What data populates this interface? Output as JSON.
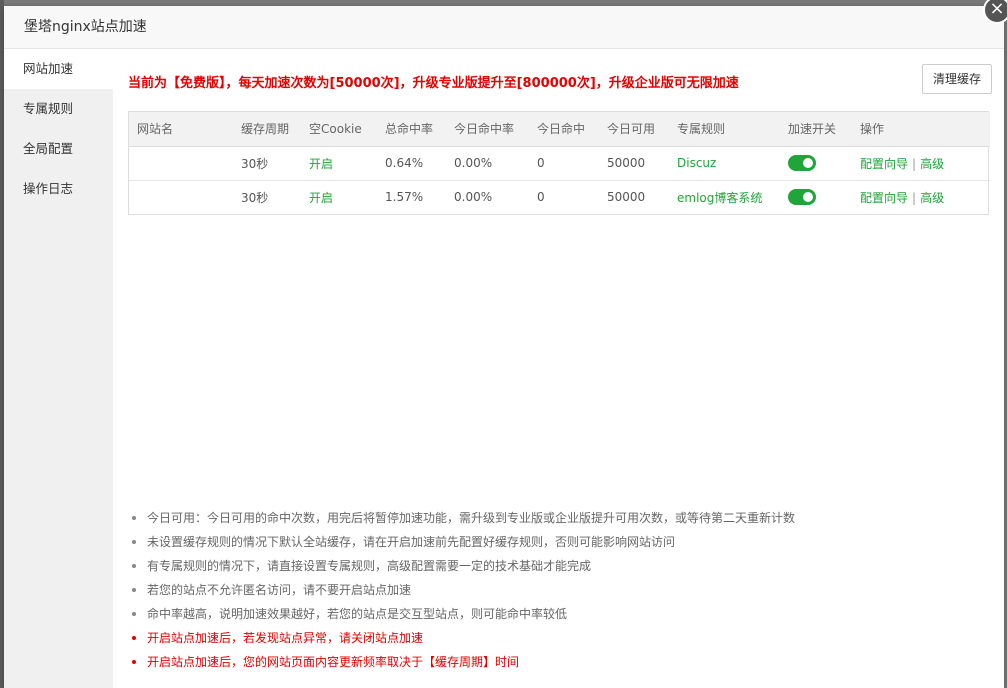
{
  "dialog": {
    "title": "堡塔nginx站点加速",
    "close_glyph": "×"
  },
  "sidebar": {
    "items": [
      {
        "label": "网站加速",
        "active": true
      },
      {
        "label": "专属规则"
      },
      {
        "label": "全局配置"
      },
      {
        "label": "操作日志"
      }
    ]
  },
  "main": {
    "notice": "当前为【免费版】，每天加速次数为[50000次]，升级专业版提升至[800000次]，升级企业版可无限加速",
    "clear_cache_label": "清理缓存",
    "table": {
      "headers": [
        "网站名",
        "缓存周期",
        "空Cookie",
        "总命中率",
        "今日命中率",
        "今日命中",
        "今日可用",
        "专属规则",
        "加速开关",
        "操作"
      ],
      "rows": [
        {
          "site": "",
          "cache_period": "30秒",
          "empty_cookie": "开启",
          "total_hit_rate": "0.64%",
          "today_hit_rate": "0.00%",
          "today_hits": "0",
          "today_available": "50000",
          "rule": "Discuz",
          "switch_on": true,
          "action_config": "配置向导",
          "action_sep": "|",
          "action_advanced": "高级"
        },
        {
          "site": "",
          "cache_period": "30秒",
          "empty_cookie": "开启",
          "total_hit_rate": "1.57%",
          "today_hit_rate": "0.00%",
          "today_hits": "0",
          "today_available": "50000",
          "rule": "emlog博客系统",
          "switch_on": true,
          "action_config": "配置向导",
          "action_sep": "|",
          "action_advanced": "高级"
        }
      ]
    },
    "tips": [
      {
        "text": "今日可用：今日可用的命中次数，用完后将暂停加速功能，需升级到专业版或企业版提升可用次数，或等待第二天重新计数",
        "red": false
      },
      {
        "text": "未设置缓存规则的情况下默认全站缓存，请在开启加速前先配置好缓存规则，否则可能影响网站访问",
        "red": false
      },
      {
        "text": "有专属规则的情况下，请直接设置专属规则，高级配置需要一定的技术基础才能完成",
        "red": false
      },
      {
        "text": "若您的站点不允许匿名访问，请不要开启站点加速",
        "red": false
      },
      {
        "text": "命中率越高，说明加速效果越好，若您的站点是交互型站点，则可能命中率较低",
        "red": false
      },
      {
        "text": "开启站点加速后，若发现站点异常，请关闭站点加速",
        "red": true
      },
      {
        "text": "开启站点加速后，您的网站页面内容更新频率取决于【缓存周期】时间",
        "red": true
      }
    ]
  },
  "colors": {
    "accent_green": "#20a53a",
    "warning_red": "#e60000"
  }
}
